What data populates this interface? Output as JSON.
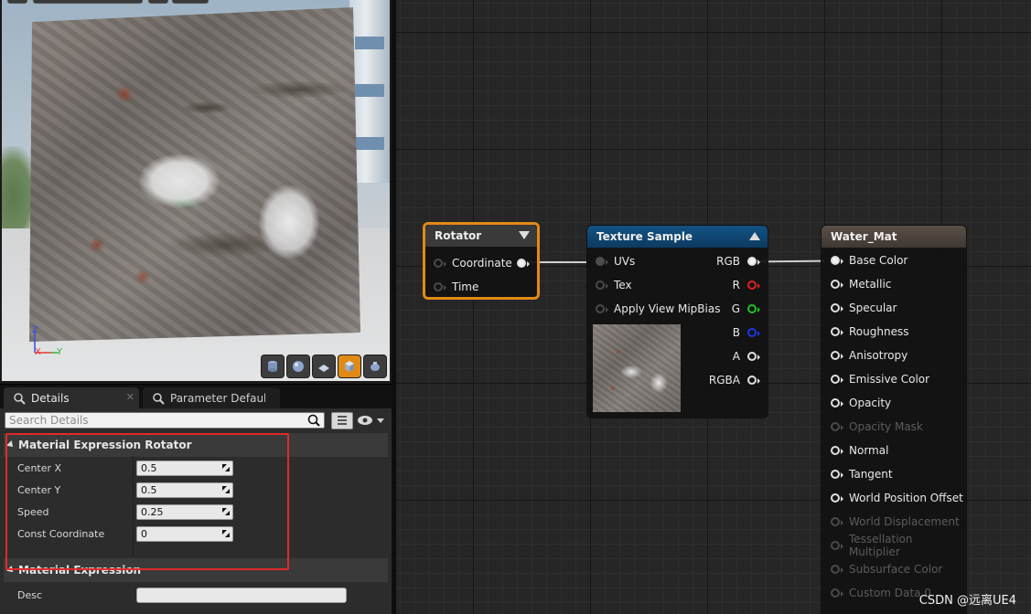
{
  "details_panel": {
    "tabs": [
      {
        "label": "Details"
      },
      {
        "label": "Parameter Defaults"
      }
    ],
    "search_placeholder": "Search Details",
    "categories": [
      {
        "title": "Material Expression Rotator"
      },
      {
        "title": "Material Expression"
      }
    ],
    "properties": [
      {
        "label": "Center X",
        "value": "0.5"
      },
      {
        "label": "Center Y",
        "value": "0.5"
      },
      {
        "label": "Speed",
        "value": "0.25"
      },
      {
        "label": "Const Coordinate",
        "value": "0"
      }
    ],
    "desc": {
      "label": "Desc",
      "value": ""
    }
  },
  "viewport": {
    "axis_z": "Z",
    "axis_x": "X",
    "axis_y": "Y"
  },
  "graph": {
    "rotator": {
      "title": "Rotator",
      "inputs": [
        "Coordinate",
        "Time"
      ]
    },
    "texture_sample": {
      "title": "Texture Sample",
      "inputs": [
        "UVs",
        "Tex",
        "Apply View MipBias"
      ],
      "outputs": [
        "RGB",
        "R",
        "G",
        "B",
        "A",
        "RGBA"
      ]
    },
    "water_mat": {
      "title": "Water_Mat",
      "pins": [
        {
          "label": "Base Color",
          "enabled": true
        },
        {
          "label": "Metallic",
          "enabled": true
        },
        {
          "label": "Specular",
          "enabled": true
        },
        {
          "label": "Roughness",
          "enabled": true
        },
        {
          "label": "Anisotropy",
          "enabled": true
        },
        {
          "label": "Emissive Color",
          "enabled": true
        },
        {
          "label": "Opacity",
          "enabled": true
        },
        {
          "label": "Opacity Mask",
          "enabled": false
        },
        {
          "label": "Normal",
          "enabled": true
        },
        {
          "label": "Tangent",
          "enabled": true
        },
        {
          "label": "World Position Offset",
          "enabled": true
        },
        {
          "label": "World Displacement",
          "enabled": false
        },
        {
          "label": "Tessellation Multiplier",
          "enabled": false
        },
        {
          "label": "Subsurface Color",
          "enabled": false
        },
        {
          "label": "Custom Data 0",
          "enabled": false
        }
      ]
    }
  },
  "colors": {
    "rotator_header": "#3a3a3a",
    "rotator_selected": "#e08a15",
    "texture_header": "#10456f",
    "material_header": "#4d453e",
    "highlight_box": "#e02a2a"
  },
  "watermark": "CSDN @远离UE4"
}
